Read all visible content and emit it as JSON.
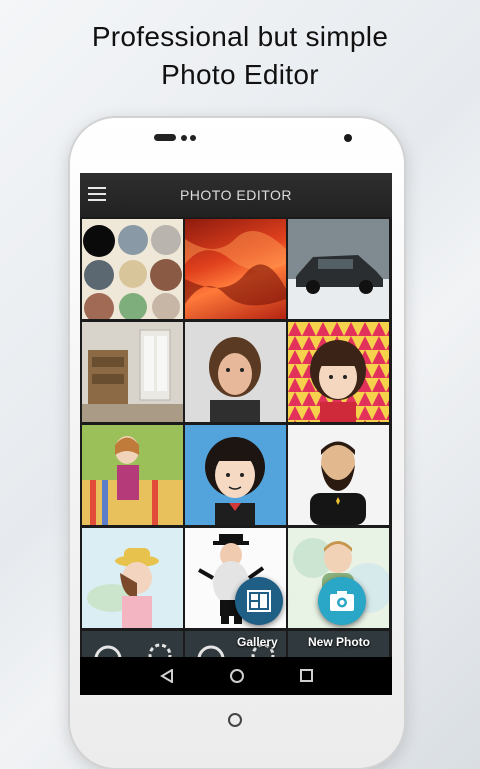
{
  "promo": {
    "line1": "Professional but simple",
    "line2": "Photo Editor"
  },
  "app": {
    "title": "PHOTO EDITOR"
  },
  "gallery": {
    "tiles": [
      {
        "id": "collage-circles"
      },
      {
        "id": "red-hair"
      },
      {
        "id": "car-snow"
      },
      {
        "id": "room-bookshelf"
      },
      {
        "id": "girl-portrait"
      },
      {
        "id": "cartoon-girl-triangles"
      },
      {
        "id": "cartoon-girl-colorful"
      },
      {
        "id": "cartoon-girl-blue"
      },
      {
        "id": "cartoon-man-beard"
      },
      {
        "id": "cartoon-girl-hat"
      },
      {
        "id": "cartoon-man-hat"
      },
      {
        "id": "cartoon-boy-watercolor"
      }
    ]
  },
  "fabs": {
    "gallery_label": "Gallery",
    "new_photo_label": "New Photo"
  },
  "colors": {
    "fab_gallery": "#1f5f86",
    "fab_new_photo": "#2aa6c6",
    "appbar": "#2a2a2a"
  }
}
